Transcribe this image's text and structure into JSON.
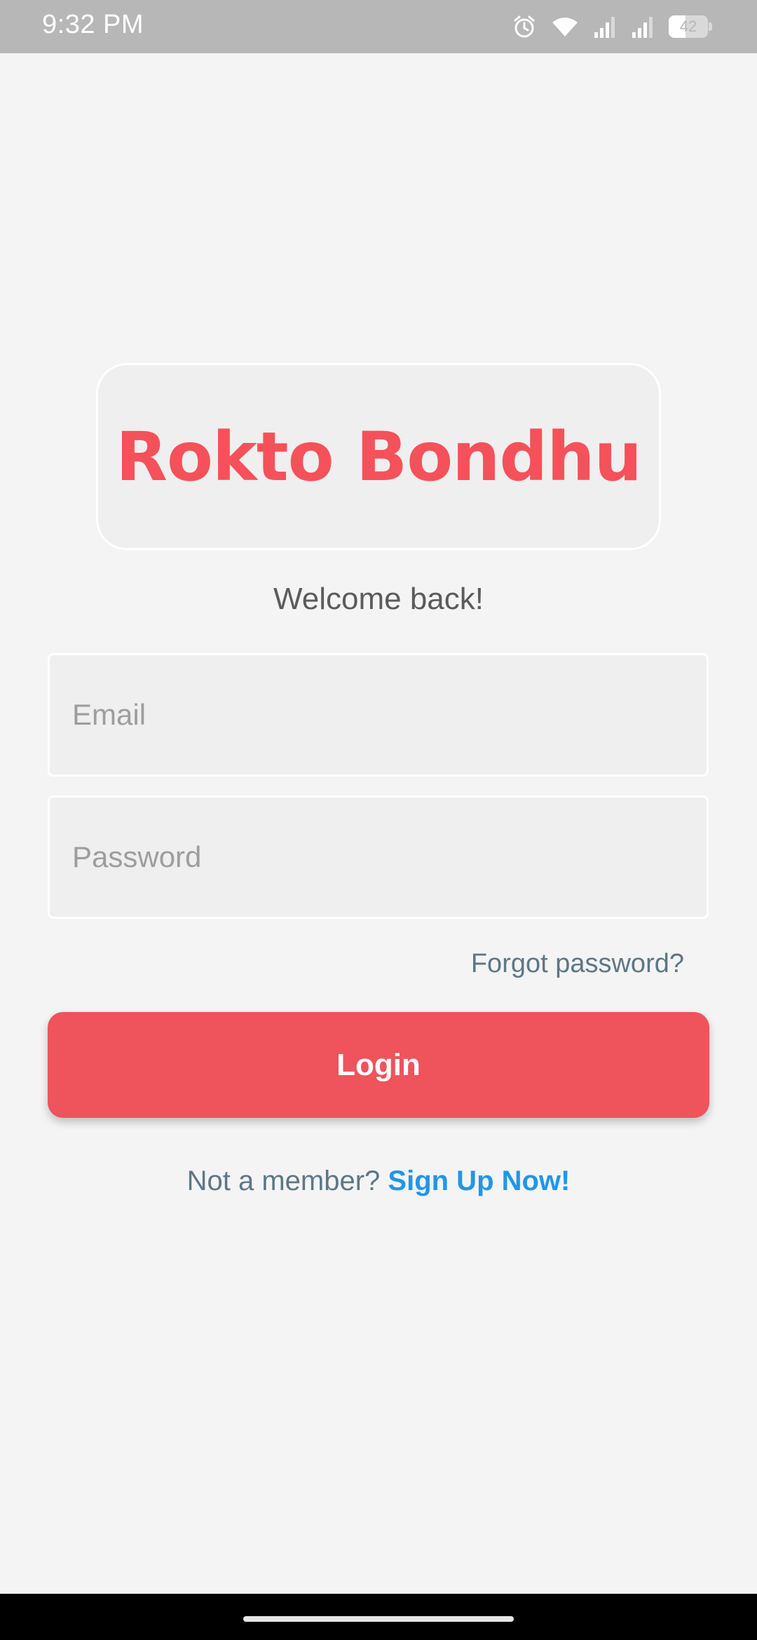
{
  "status_bar": {
    "time": "9:32 PM",
    "battery_level": "42",
    "battery_fraction": 0.42,
    "icons": [
      "alarm-icon",
      "wifi-icon",
      "signal-icon",
      "signal-icon",
      "battery-icon"
    ]
  },
  "app": {
    "logo_text": "Rokto Bondhu",
    "welcome_text": "Welcome back!"
  },
  "form": {
    "email_placeholder": "Email",
    "email_value": "",
    "password_placeholder": "Password",
    "password_value": "",
    "forgot_password": "Forgot password?",
    "login_label": "Login"
  },
  "signup": {
    "prompt": "Not a member?",
    "link": "Sign Up Now!"
  },
  "colors": {
    "brand_red": "#f5515a",
    "button_red": "#ef535c",
    "link_blue": "#2196e9",
    "muted_text": "#5d7785",
    "background": "#f4f4f4"
  }
}
